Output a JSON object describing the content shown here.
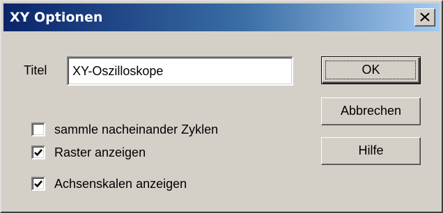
{
  "window": {
    "title": "XY Optionen",
    "close_glyph": "close-icon"
  },
  "form": {
    "title_label": "Titel",
    "title_value": "XY-Oszilloskope"
  },
  "buttons": {
    "ok_label": "OK",
    "cancel_label": "Abbrechen",
    "help_label": "Hilfe"
  },
  "options": [
    {
      "label": "sammle nacheinander Zyklen",
      "checked": false
    },
    {
      "label": "Raster anzeigen",
      "checked": true
    },
    {
      "label": "Achsenskalen anzeigen",
      "checked": true
    }
  ],
  "colors": {
    "dialog_face": "#d4d0c8",
    "titlebar_start": "#0a246a",
    "titlebar_end": "#a6caf0",
    "title_text": "#ffffff"
  }
}
